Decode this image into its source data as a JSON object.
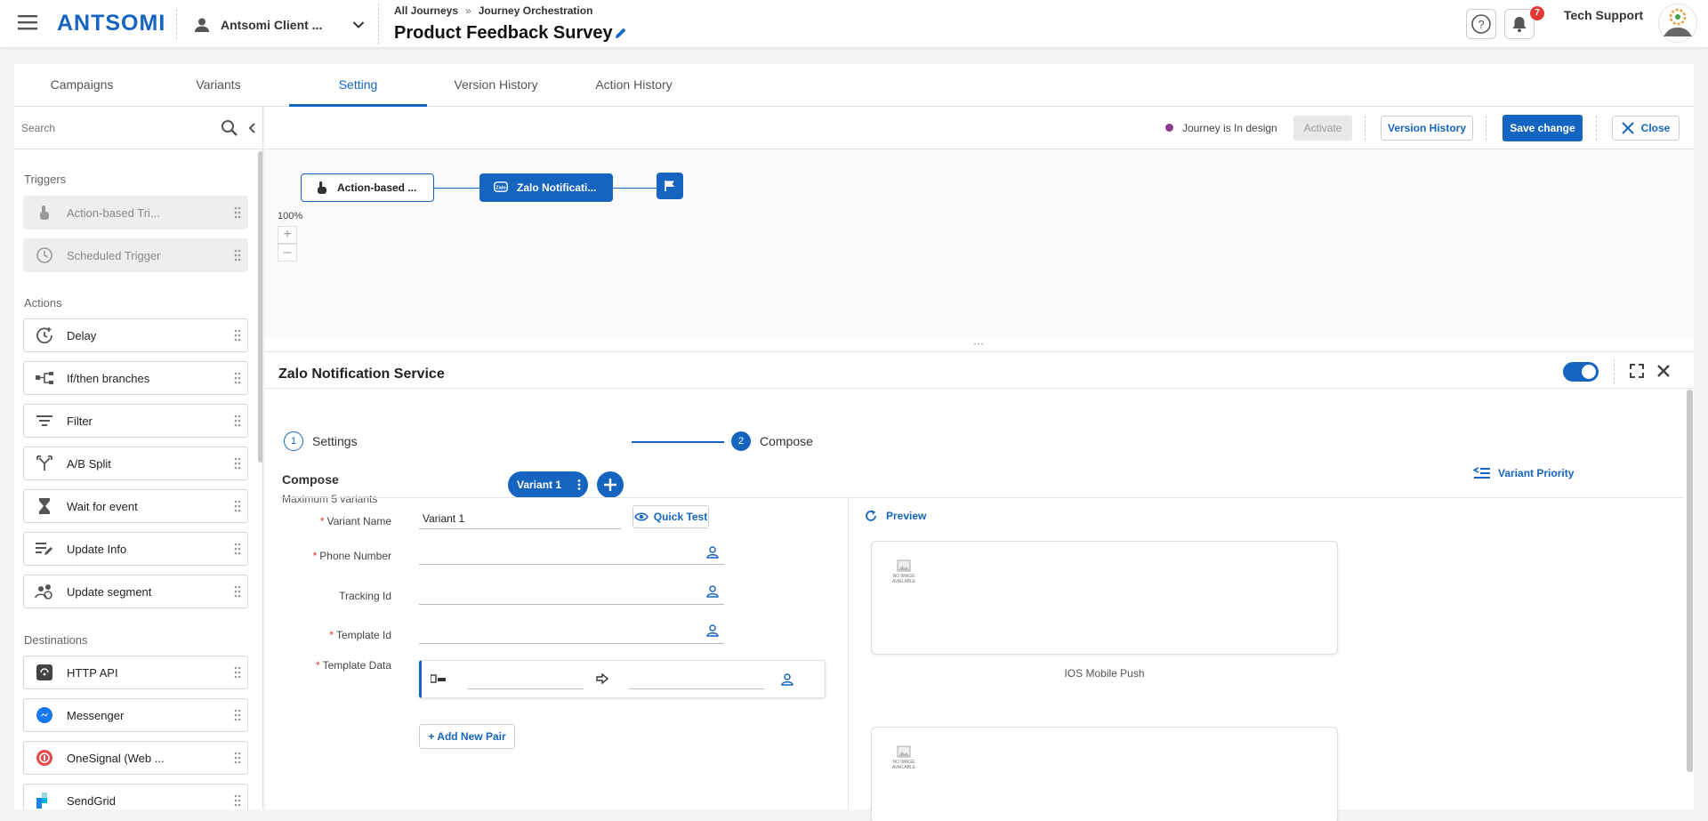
{
  "header": {
    "brand": "ANTSOMI",
    "account_name": "Antsomi Client ...",
    "breadcrumb": [
      "All Journeys",
      "Journey Orchestration"
    ],
    "breadcrumb_sep": "»",
    "journey_title": "Product Feedback Survey",
    "notification_count": "7",
    "user_name": "Tech Support"
  },
  "tabs": [
    {
      "label": "Campaigns",
      "active": false
    },
    {
      "label": "Variants",
      "active": false
    },
    {
      "label": "Setting",
      "active": true
    },
    {
      "label": "Version History",
      "active": false
    },
    {
      "label": "Action History",
      "active": false
    }
  ],
  "sidebar": {
    "search_placeholder": "Search",
    "sections": {
      "triggers": "Triggers",
      "actions": "Actions",
      "destinations": "Destinations"
    },
    "triggers": [
      {
        "label": "Action-based Tri...",
        "icon": "hand-pointer-icon"
      },
      {
        "label": "Scheduled Trigger",
        "icon": "clock-icon"
      }
    ],
    "actions": [
      {
        "label": "Delay",
        "icon": "delay-icon"
      },
      {
        "label": "If/then branches",
        "icon": "branch-icon"
      },
      {
        "label": "Filter",
        "icon": "filter-icon"
      },
      {
        "label": "A/B Split",
        "icon": "split-icon"
      },
      {
        "label": "Wait for event",
        "icon": "hourglass-icon"
      },
      {
        "label": "Update Info",
        "icon": "edit-list-icon"
      },
      {
        "label": "Update segment",
        "icon": "segment-icon"
      }
    ],
    "destinations": [
      {
        "label": "HTTP API",
        "icon": "http-api-icon"
      },
      {
        "label": "Messenger",
        "icon": "messenger-icon"
      },
      {
        "label": "OneSignal (Web ...",
        "icon": "onesignal-icon"
      },
      {
        "label": "SendGrid",
        "icon": "sendgrid-icon"
      }
    ]
  },
  "toolbar": {
    "status_text": "Journey is In design",
    "status_color": "#8e3a8e",
    "activate": "Activate",
    "version_history": "Version History",
    "save_change": "Save change",
    "close": "Close"
  },
  "flow": {
    "trigger_node": "Action-based ...",
    "action_node": "Zalo Notificati...",
    "zoom": "100%"
  },
  "panel": {
    "title": "Zalo Notification Service",
    "enabled": true,
    "steps": [
      {
        "num": "1",
        "label": "Settings",
        "active": false
      },
      {
        "num": "2",
        "label": "Compose",
        "active": true
      }
    ],
    "compose_title": "Compose",
    "compose_sub": "Maximum 5 variants",
    "variant_chip": "Variant 1",
    "variant_priority": "Variant Priority",
    "fields": {
      "variant_name_label": "Variant Name",
      "variant_name_value": "Variant 1",
      "quick_test": "Quick Test",
      "phone_label": "Phone Number",
      "tracking_label": "Tracking Id",
      "template_id_label": "Template Id",
      "template_data_label": "Template Data",
      "add_pair": "+ Add New Pair"
    },
    "preview": {
      "label": "Preview",
      "no_image_text": "NO IMAGE AVAILABLE",
      "card1_caption": "IOS Mobile Push"
    }
  },
  "colors": {
    "primary": "#1565c0",
    "danger": "#e53935"
  }
}
